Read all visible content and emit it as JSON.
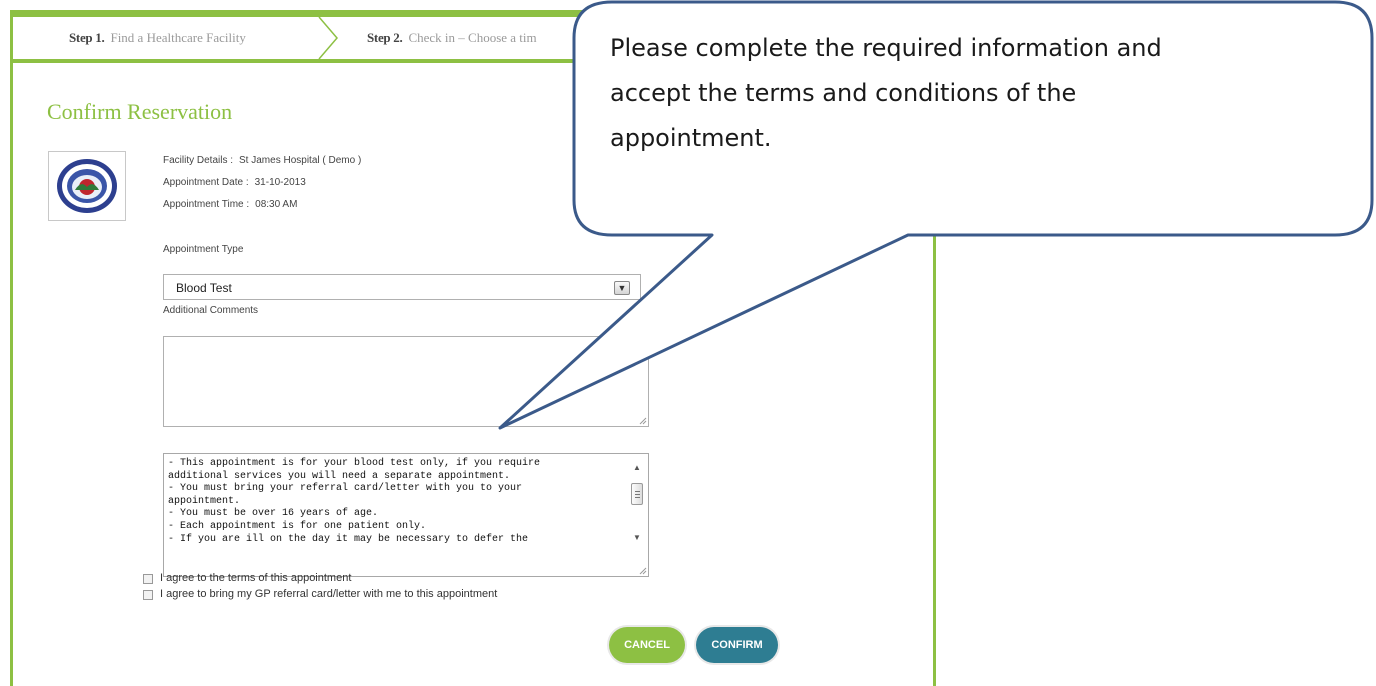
{
  "steps": {
    "step1": {
      "num": "Step 1.",
      "label": "Find a Healthcare Facility"
    },
    "step2": {
      "num": "Step 2.",
      "label": "Check in – Choose a tim"
    }
  },
  "page_title": "Confirm Reservation",
  "facility": {
    "details_label": "Facility Details :",
    "details_value": "St James Hospital ( Demo )",
    "date_label": "Appointment Date :",
    "date_value": "31-10-2013",
    "time_label": "Appointment Time :",
    "time_value": "08:30 AM"
  },
  "appointment_type": {
    "label": "Appointment Type",
    "selected": "Blood Test"
  },
  "additional_comments": {
    "label": "Additional Comments",
    "value": ""
  },
  "terms_lines": [
    "- This appointment is for your blood test only, if you require",
    "additional services you will need a separate appointment.",
    "- You must bring your referral card/letter with you to your",
    "appointment.",
    "- You must be over 16 years of age.",
    "- Each appointment is for one patient only.",
    "- If you are ill on the day it may be necessary to defer the"
  ],
  "checkboxes": {
    "agree_terms": "I agree to the terms of this appointment",
    "agree_referral": "I agree to bring my GP referral card/letter with me to this appointment"
  },
  "buttons": {
    "cancel": "CANCEL",
    "confirm": "CONFIRM"
  },
  "callout": {
    "lines": [
      "Please complete the required information and",
      "accept the terms and conditions of the",
      "appointment."
    ]
  },
  "colors": {
    "brand_green": "#8dc043",
    "confirm_teal": "#2e7d92",
    "callout_border": "#3b5a8a"
  }
}
